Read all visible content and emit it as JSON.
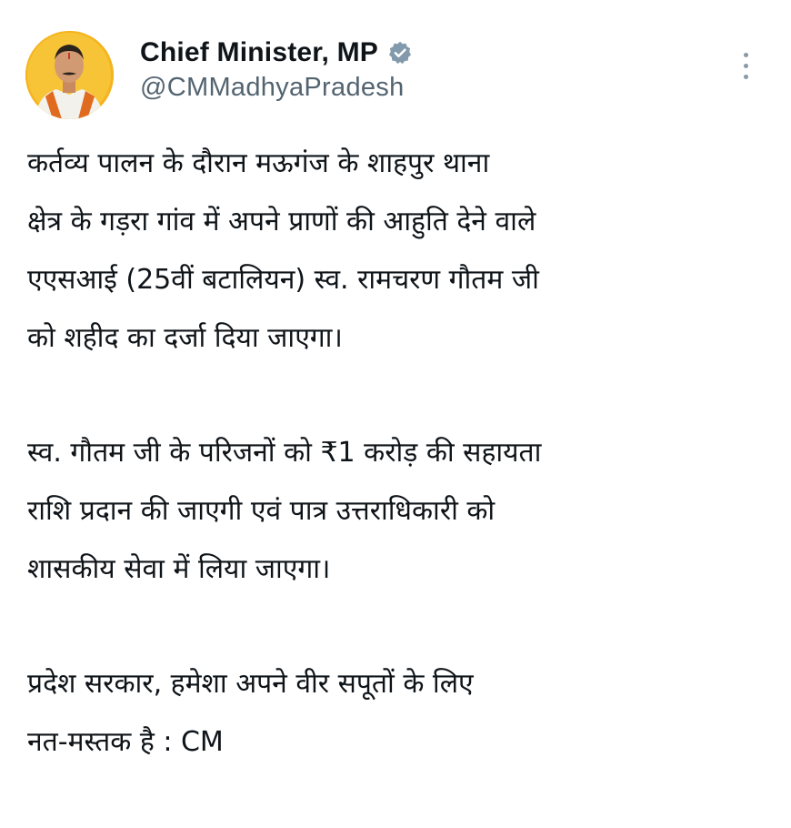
{
  "author": {
    "display_name": "Chief Minister, MP",
    "handle": "@CMMadhyaPradesh",
    "verified_icon": "verified-badge-icon",
    "avatar": "avatar"
  },
  "menu": {
    "icon": "more-options-icon"
  },
  "tweet": {
    "paragraphs": [
      {
        "lines": [
          "कर्तव्य पालन के दौरान मऊगंज के शाहपुर थाना",
          "क्षेत्र के गड़रा गांव में अपने प्राणों की आहुति देने वाले",
          "एएसआई (25वीं बटालियन) स्व. रामचरण गौतम जी",
          "को शहीद का दर्जा दिया जाएगा।"
        ]
      },
      {
        "lines": [
          "स्व. गौतम जी के परिजनों को ₹1 करोड़ की सहायता",
          "राशि प्रदान की जाएगी एवं पात्र उत्तराधिकारी को",
          "शासकीय सेवा में लिया जाएगा।"
        ]
      },
      {
        "lines": [
          "प्रदेश सरकार, हमेशा अपने वीर सपूतों के लिए",
          "नत-मस्तक है : CM"
        ]
      }
    ]
  }
}
